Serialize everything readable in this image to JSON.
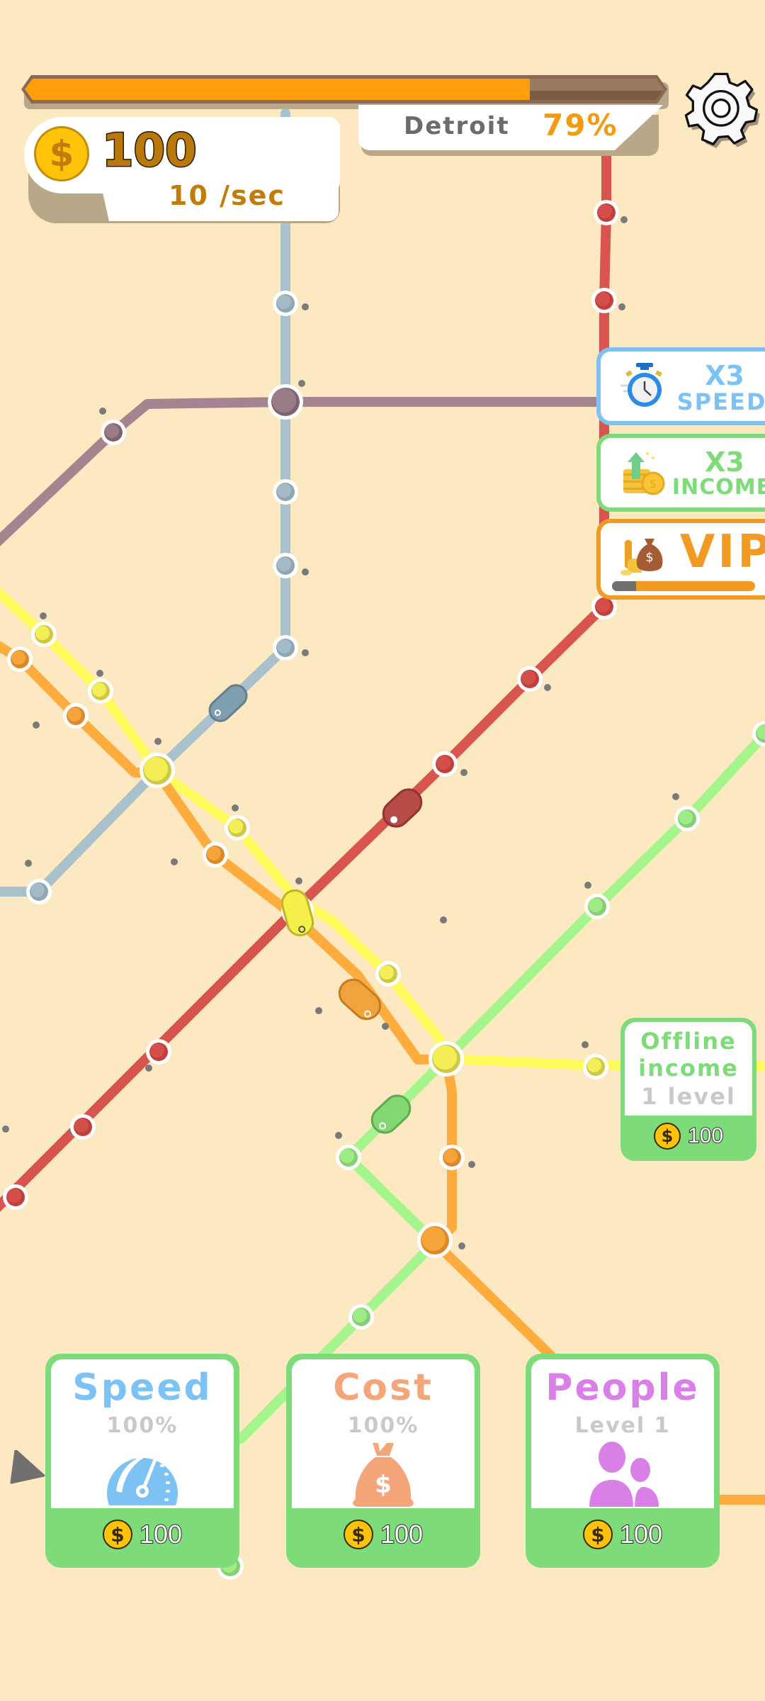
{
  "header": {
    "city_name": "Detroit",
    "city_progress_label": "79%",
    "city_progress": 0.79,
    "money": "100",
    "income_rate": "10 /sec",
    "settings_icon": "gear-icon"
  },
  "boosts": [
    {
      "id": "speed",
      "line1": "X3",
      "line2": "SPEED",
      "icon": "stopwatch-icon",
      "color": "#7cc2f5"
    },
    {
      "id": "income",
      "line1": "X3",
      "line2": "INCOME",
      "icon": "coins-arrow-up-icon",
      "color": "#7ddb7a"
    },
    {
      "id": "vip",
      "line1": "VIP",
      "icon": "money-bag-icon",
      "color": "#f29a22",
      "progress": 0.17
    }
  ],
  "offline_income": {
    "line1": "Offline",
    "line2": "income",
    "line3": "1 level",
    "price": "100"
  },
  "upgrades": [
    {
      "id": "speed",
      "title": "Speed",
      "subtitle": "100%",
      "icon": "speedometer-icon",
      "price": "100",
      "color": "#7cc2f5"
    },
    {
      "id": "cost",
      "title": "Cost",
      "subtitle": "100%",
      "icon": "money-bag-icon",
      "price": "100",
      "color": "#f5a57a"
    },
    {
      "id": "people",
      "title": "People",
      "subtitle": "Level 1",
      "icon": "people-icon",
      "price": "100",
      "color": "#da7ee8"
    }
  ],
  "map": {
    "background": "#fde9c1",
    "lines": [
      {
        "name": "red",
        "color": "#d9534f"
      },
      {
        "name": "gray-blue",
        "color": "#a9c1cc"
      },
      {
        "name": "mauve",
        "color": "#a3848f"
      },
      {
        "name": "yellow",
        "color": "#fffb5c"
      },
      {
        "name": "orange",
        "color": "#ffac3f"
      },
      {
        "name": "green",
        "color": "#a4f58c"
      }
    ],
    "trains": [
      "gray-blue",
      "red",
      "yellow",
      "orange",
      "green"
    ]
  }
}
